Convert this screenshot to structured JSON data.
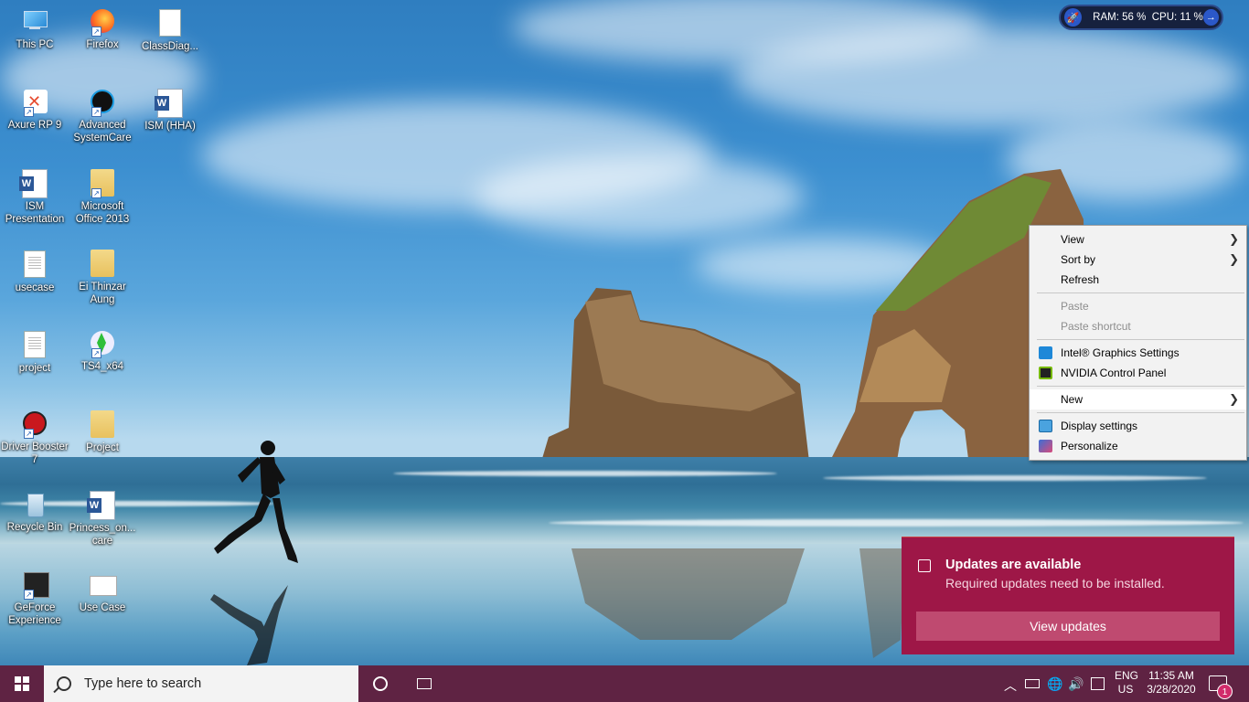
{
  "desktop": {
    "icons": [
      {
        "label": "This PC"
      },
      {
        "label": "Firefox"
      },
      {
        "label": "ClassDiag..."
      },
      {
        "label": "Axure RP 9"
      },
      {
        "label": "Advanced SystemCare"
      },
      {
        "label": "ISM (HHA)"
      },
      {
        "label": "ISM Presentation"
      },
      {
        "label": "Microsoft Office 2013"
      },
      {
        "label": "usecase"
      },
      {
        "label": "Ei Thinzar Aung"
      },
      {
        "label": "project"
      },
      {
        "label": "TS4_x64"
      },
      {
        "label": "Driver Booster 7"
      },
      {
        "label": "Project"
      },
      {
        "label": "Recycle Bin"
      },
      {
        "label": "Princess_on... care"
      },
      {
        "label": "GeForce Experience"
      },
      {
        "label": "Use Case"
      }
    ]
  },
  "perf_widget": {
    "ram_label": "RAM:",
    "ram_value": "56 %",
    "cpu_label": "CPU:",
    "cpu_value": "11 %"
  },
  "context_menu": {
    "view": "View",
    "sort_by": "Sort by",
    "refresh": "Refresh",
    "paste": "Paste",
    "paste_shortcut": "Paste shortcut",
    "intel": "Intel® Graphics Settings",
    "nvidia": "NVIDIA Control Panel",
    "new": "New",
    "display_settings": "Display settings",
    "personalize": "Personalize"
  },
  "toast": {
    "title": "Updates are available",
    "message": "Required updates need to be installed.",
    "button": "View updates",
    "color": "#9e1747"
  },
  "taskbar": {
    "search_placeholder": "Type here to search",
    "lang_top": "ENG",
    "lang_bottom": "US",
    "time": "11:35 AM",
    "date": "3/28/2020",
    "notification_count": "1",
    "color": "#5f2343"
  }
}
